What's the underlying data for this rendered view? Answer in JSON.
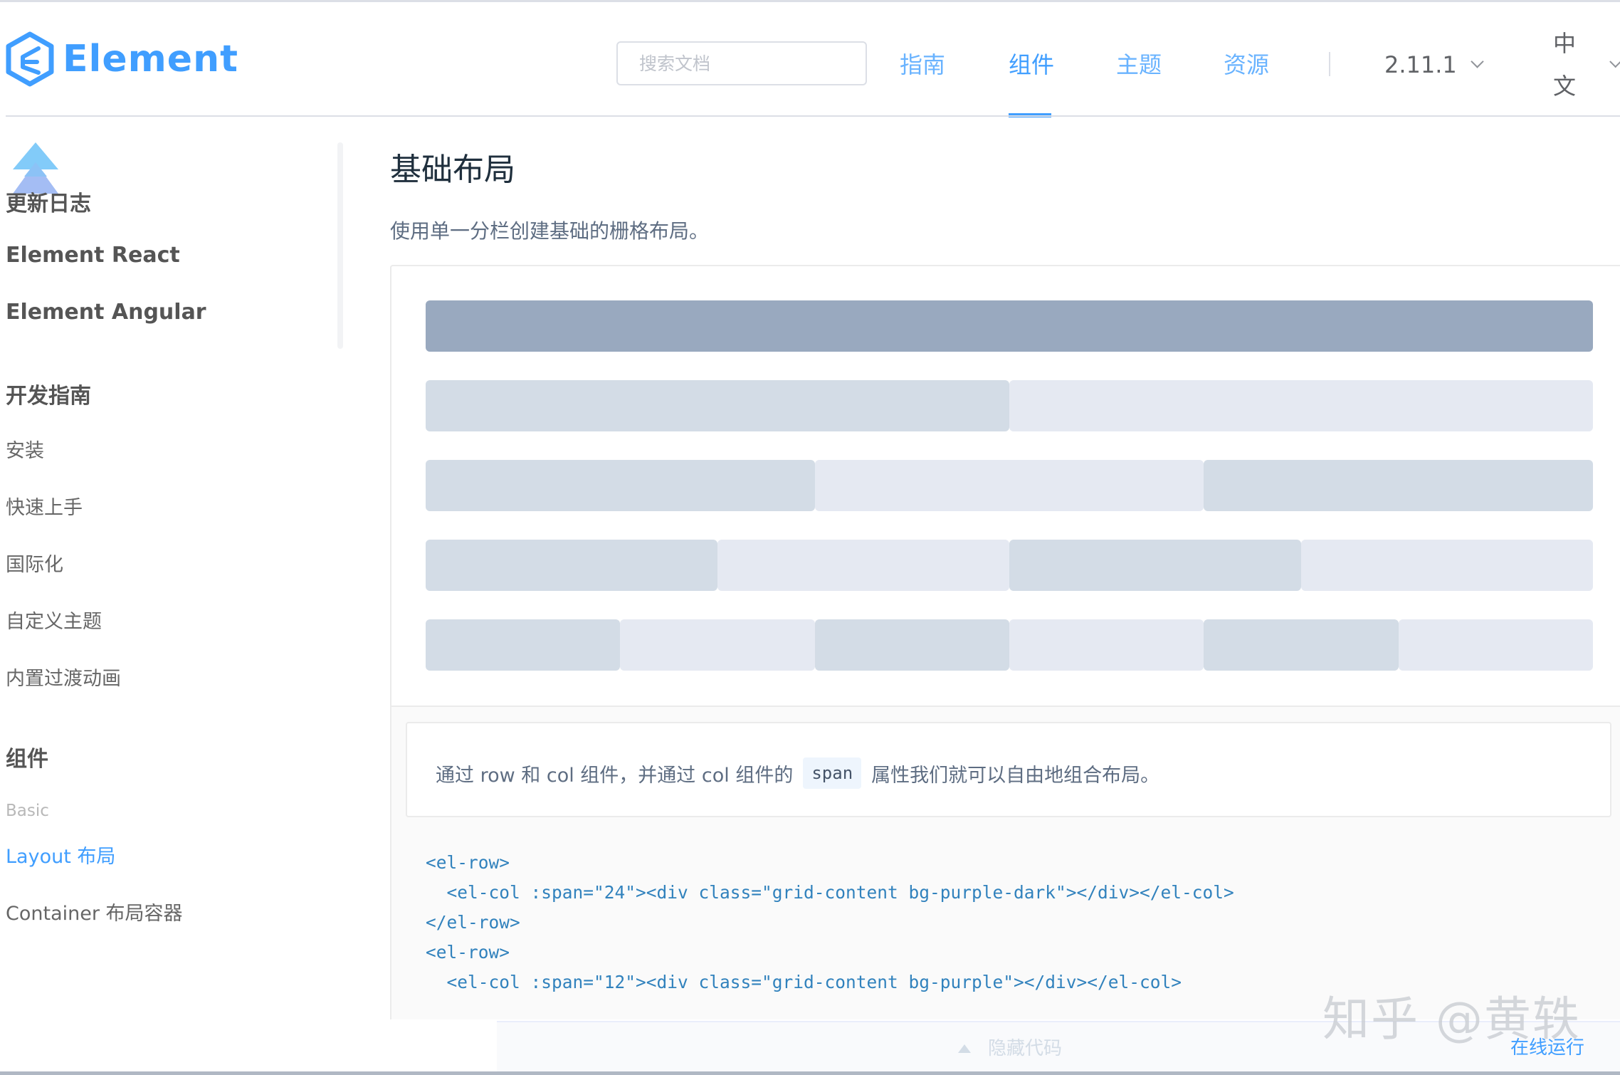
{
  "header": {
    "logo_text": "Element",
    "search_placeholder": "搜索文档",
    "nav": [
      {
        "label": "指南"
      },
      {
        "label": "组件"
      },
      {
        "label": "主题"
      },
      {
        "label": "资源"
      }
    ],
    "active_nav": "组件",
    "version": "2.11.1",
    "language": "中文"
  },
  "sidebar": {
    "top_links": [
      "更新日志",
      "Element React",
      "Element Angular"
    ],
    "guide_heading": "开发指南",
    "guide_items": [
      "安装",
      "快速上手",
      "国际化",
      "自定义主题",
      "内置过渡动画"
    ],
    "component_heading": "组件",
    "category_basic": "Basic",
    "component_items": [
      "Layout 布局",
      "Container 布局容器"
    ],
    "active_item": "Layout 布局"
  },
  "main": {
    "title": "基础布局",
    "description": "使用单一分栏创建基础的栅格布局。",
    "grid_rows": [
      {
        "spans": [
          24
        ]
      },
      {
        "spans": [
          12,
          12
        ]
      },
      {
        "spans": [
          8,
          8,
          8
        ]
      },
      {
        "spans": [
          6,
          6,
          6,
          6
        ]
      },
      {
        "spans": [
          4,
          4,
          4,
          4,
          4,
          4
        ]
      }
    ],
    "meta_desc_before": "通过 row 和 col 组件，并通过 col 组件的",
    "meta_desc_code": "span",
    "meta_desc_after": "属性我们就可以自由地组合布局。",
    "code_lines": [
      "<el-row>",
      "  <el-col :span=\"24\"><div class=\"grid-content bg-purple-dark\"></div></el-col>",
      "</el-row>",
      "<el-row>",
      "  <el-col :span=\"12\"><div class=\"grid-content bg-purple\"></div></el-col>"
    ]
  },
  "control": {
    "hide_code": "隐藏代码",
    "run_online": "在线运行"
  },
  "watermark": "知乎 @黄轶",
  "colors": {
    "accent": "#409eff",
    "bg_purple_dark": "#99a9bf",
    "bg_purple": "#d3dce6",
    "bg_purple_light": "#e5e9f2"
  }
}
